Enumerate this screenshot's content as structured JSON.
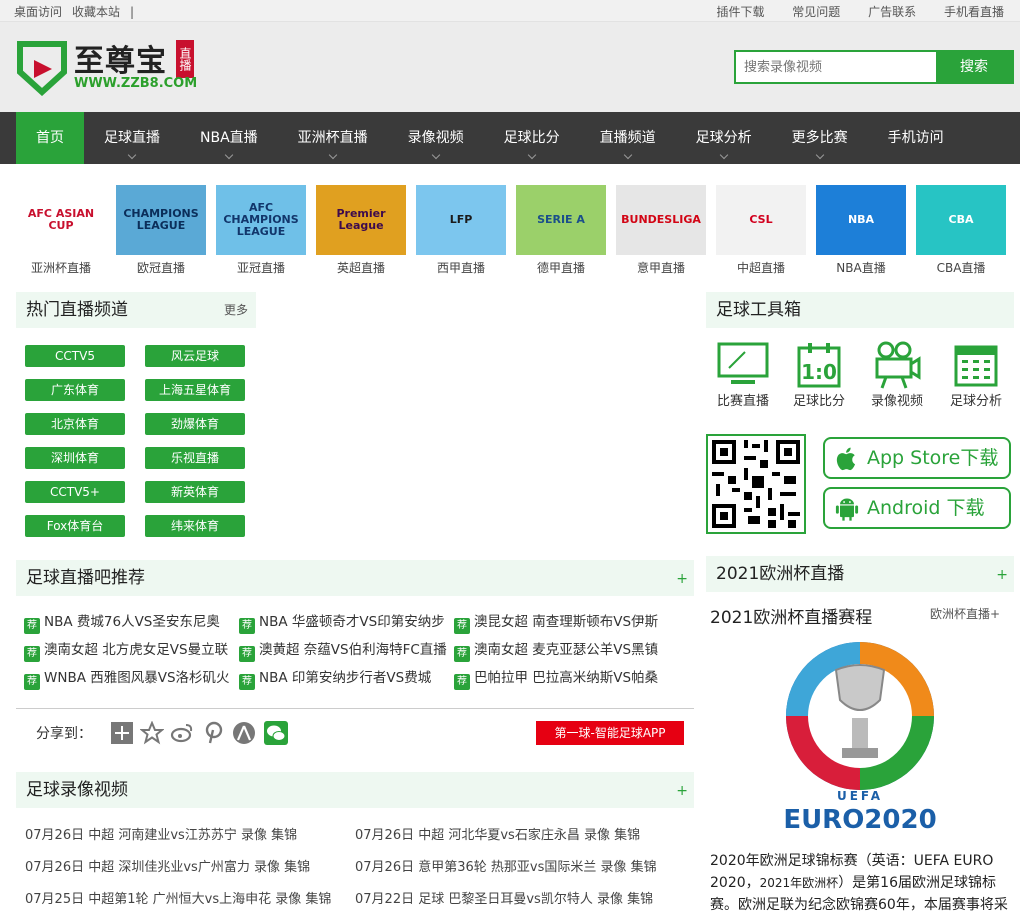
{
  "topbar": {
    "left": [
      "桌面访问",
      "收藏本站"
    ],
    "right": [
      "插件下载",
      "常见问题",
      "广告联系",
      "手机看直播"
    ]
  },
  "logo": {
    "name": "至尊宝",
    "tag": "直播",
    "url": "WWW.ZZB8.COM"
  },
  "search": {
    "placeholder": "搜索录像视频",
    "button": "搜索"
  },
  "nav": {
    "items": [
      "首页",
      "足球直播",
      "NBA直播",
      "亚洲杯直播",
      "录像视频",
      "足球比分",
      "直播频道",
      "足球分析",
      "更多比赛",
      "手机访问"
    ]
  },
  "leagues": [
    {
      "label": "亚洲杯直播",
      "text": "AFC ASIAN CUP",
      "bg": "#ffffff",
      "fg": "#c8102e"
    },
    {
      "label": "欧冠直播",
      "text": "CHAMPIONS LEAGUE",
      "bg": "#5aa9d6",
      "fg": "#0b2e5a"
    },
    {
      "label": "亚冠直播",
      "text": "AFC CHAMPIONS LEAGUE",
      "bg": "#6fc0e8",
      "fg": "#12366b"
    },
    {
      "label": "英超直播",
      "text": "Premier League",
      "bg": "#e0a020",
      "fg": "#3d0a4d"
    },
    {
      "label": "西甲直播",
      "text": "LFP",
      "bg": "#7cc6ee",
      "fg": "#1b1b1b"
    },
    {
      "label": "德甲直播",
      "text": "SERIE A",
      "bg": "#9bd06a",
      "fg": "#1b4f8a"
    },
    {
      "label": "意甲直播",
      "text": "BUNDESLIGA",
      "bg": "#e6e6e6",
      "fg": "#d20515"
    },
    {
      "label": "中超直播",
      "text": "CSL",
      "bg": "#f2f2f2",
      "fg": "#d2001e"
    },
    {
      "label": "NBA直播",
      "text": "NBA",
      "bg": "#1d7fd8",
      "fg": "#ffffff"
    },
    {
      "label": "CBA直播",
      "text": "CBA",
      "bg": "#27c4c4",
      "fg": "#ffffff"
    }
  ],
  "hot_channels": {
    "title": "热门直播频道",
    "more": "更多",
    "items": [
      "CCTV5",
      "风云足球",
      "广东体育",
      "上海五星体育",
      "北京体育",
      "劲爆体育",
      "深圳体育",
      "乐视直播",
      "CCTV5+",
      "新英体育",
      "Fox体育台",
      "纬来体育"
    ]
  },
  "recommend": {
    "title": "足球直播吧推荐",
    "plus": "+",
    "badge": "荐",
    "items": [
      "NBA 费城76人VS圣安东尼奥",
      "NBA 华盛顿奇才VS印第安纳步",
      "澳昆女超 南查理斯顿布VS伊斯",
      "澳南女超 北方虎女足VS曼立联",
      "澳黄超 奈蕴VS伯利海特FC直播",
      "澳南女超 麦克亚瑟公羊VS黑镇",
      "WNBA 西雅图风暴VS洛杉矶火",
      "NBA 印第安纳步行者VS费城",
      "巴帕拉甲 巴拉高米纳斯VS帕桑"
    ]
  },
  "share": {
    "label": "分享到：",
    "app": "第一球-智能足球APP"
  },
  "videos": {
    "title": "足球录像视频",
    "plus": "+",
    "items": [
      "07月26日 中超 河南建业vs江苏苏宁 录像 集锦",
      "07月26日 中超 河北华夏vs石家庄永昌 录像 集锦",
      "07月26日 中超 深圳佳兆业vs广州富力 录像 集锦",
      "07月26日 意甲第36轮 热那亚vs国际米兰 录像 集锦",
      "07月25日 中超第1轮 广州恒大vs上海申花 录像 集锦",
      "07月22日 足球 巴黎圣日耳曼vs凯尔特人 录像 集锦"
    ]
  },
  "toolbox": {
    "title": "足球工具箱",
    "items": [
      "比赛直播",
      "足球比分",
      "录像视频",
      "足球分析"
    ]
  },
  "downloads": {
    "appstore": "App Store下载",
    "android": "Android 下载"
  },
  "euro": {
    "title": "2021欧洲杯直播",
    "plus": "+",
    "subtitle": "2021欧洲杯直播赛程",
    "more": "欧洲杯直播+",
    "logo_text": "UEFA EURO2020",
    "desc_a": "2020年欧洲足球锦标赛（英语：UEFA EURO 2020，",
    "desc_small": "2021年欧洲杯",
    "desc_b": "）是第16届欧洲足球锦标赛。欧洲足联为纪念欧锦赛60年，本届赛事将采"
  },
  "colors": {
    "brand": "#2aa33a",
    "nav_bg": "#3a3a3a",
    "accent_red": "#e60012"
  }
}
